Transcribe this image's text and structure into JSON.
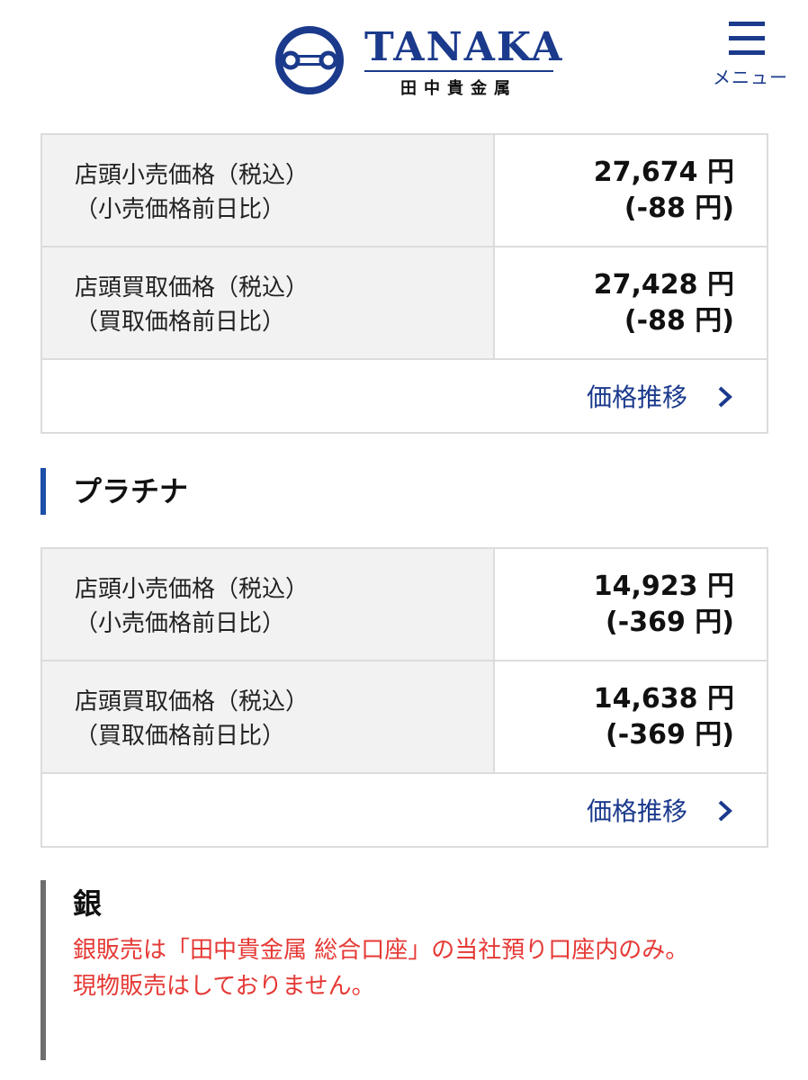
{
  "header": {
    "logo_word": "TANAKA",
    "logo_sub": "田中貴金属",
    "menu_label": "メニュー",
    "brand_color": "#1b3a8c"
  },
  "gold": {
    "retail": {
      "label_line1": "店頭小売価格（税込）",
      "label_line2": "（小売価格前日比）",
      "price": "27,674 円",
      "change": "(-88 円)"
    },
    "buyback": {
      "label_line1": "店頭買取価格（税込）",
      "label_line2": "（買取価格前日比）",
      "price": "27,428 円",
      "change": "(-88 円)"
    },
    "trend_link": "価格推移"
  },
  "platinum": {
    "heading": "プラチナ",
    "retail": {
      "label_line1": "店頭小売価格（税込）",
      "label_line2": "（小売価格前日比）",
      "price": "14,923 円",
      "change": "(-369 円)"
    },
    "buyback": {
      "label_line1": "店頭買取価格（税込）",
      "label_line2": "（買取価格前日比）",
      "price": "14,638 円",
      "change": "(-369 円)"
    },
    "trend_link": "価格推移"
  },
  "silver": {
    "heading": "銀",
    "note_line1": "銀販売は「田中貴金属 総合口座」の当社預り口座内のみ。",
    "note_line2": "現物販売はしておりません。",
    "note_color": "#e53935"
  },
  "icons": {
    "menu": "hamburger-icon",
    "chevron": "chevron-right-icon",
    "logo": "tanaka-emblem-icon"
  }
}
